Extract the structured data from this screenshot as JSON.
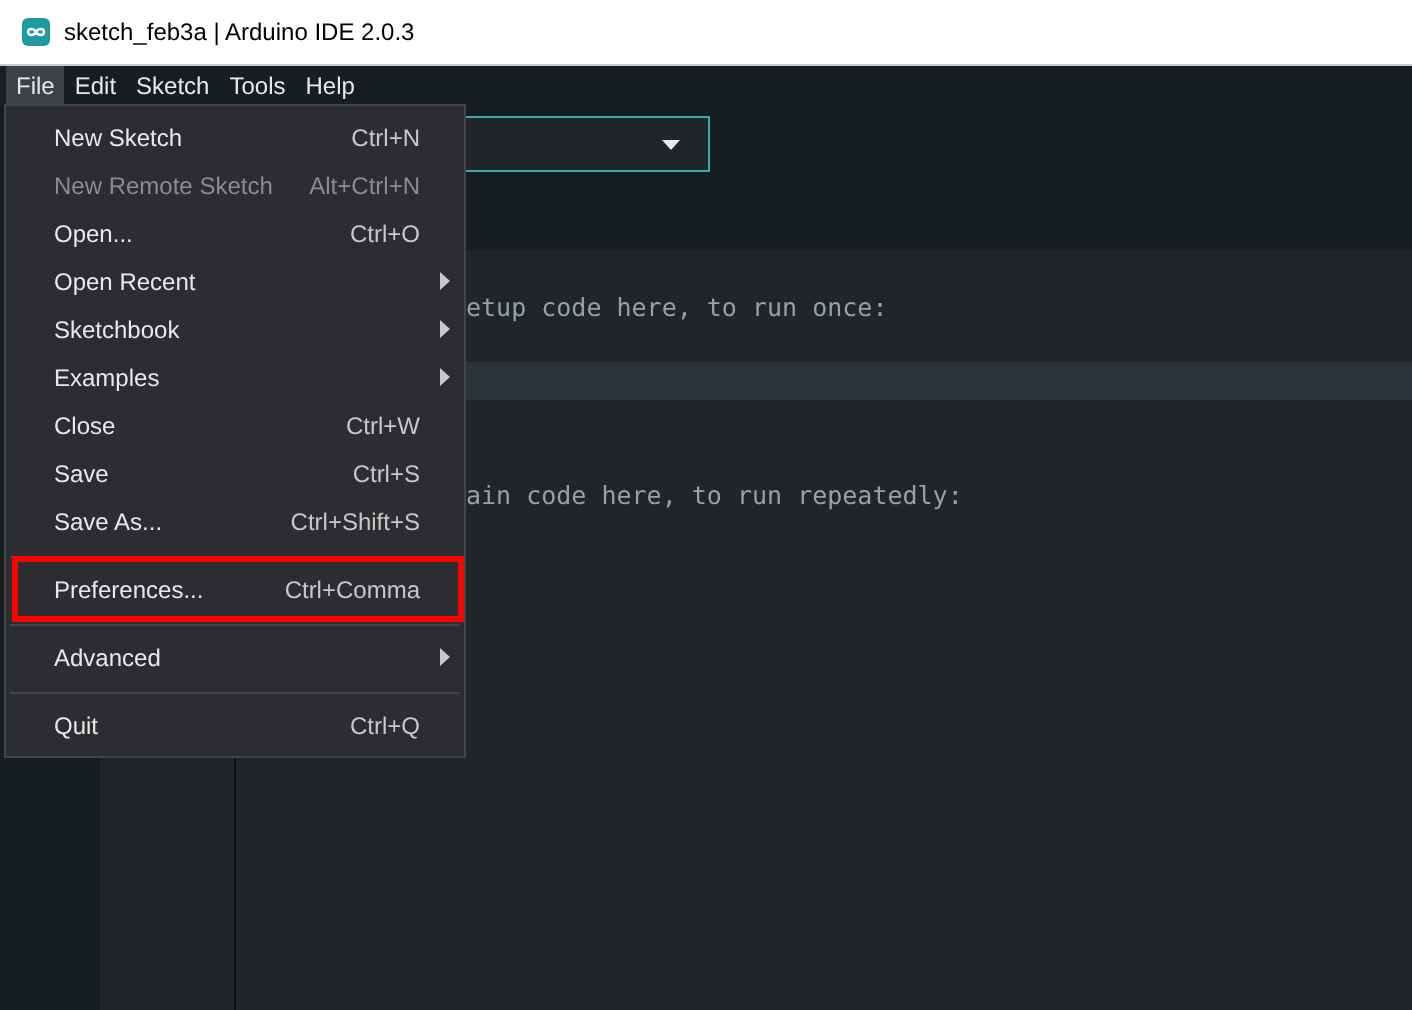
{
  "window": {
    "title": "sketch_feb3a | Arduino IDE 2.0.3"
  },
  "menubar": [
    {
      "label": "File",
      "selected": true
    },
    {
      "label": "Edit",
      "selected": false
    },
    {
      "label": "Sketch",
      "selected": false
    },
    {
      "label": "Tools",
      "selected": false
    },
    {
      "label": "Help",
      "selected": false
    }
  ],
  "file_menu": [
    [
      {
        "label": "New Sketch",
        "shortcut": "Ctrl+N",
        "disabled": false,
        "submenu": false,
        "annotated": false
      },
      {
        "label": "New Remote Sketch",
        "shortcut": "Alt+Ctrl+N",
        "disabled": true,
        "submenu": false,
        "annotated": false
      },
      {
        "label": "Open...",
        "shortcut": "Ctrl+O",
        "disabled": false,
        "submenu": false,
        "annotated": false
      },
      {
        "label": "Open Recent",
        "disabled": false,
        "submenu": true,
        "annotated": false
      },
      {
        "label": "Sketchbook",
        "disabled": false,
        "submenu": true,
        "annotated": false
      },
      {
        "label": "Examples",
        "disabled": false,
        "submenu": true,
        "annotated": false
      },
      {
        "label": "Close",
        "shortcut": "Ctrl+W",
        "disabled": false,
        "submenu": false,
        "annotated": false
      },
      {
        "label": "Save",
        "shortcut": "Ctrl+S",
        "disabled": false,
        "submenu": false,
        "annotated": false
      },
      {
        "label": "Save As...",
        "shortcut": "Ctrl+Shift+S",
        "disabled": false,
        "submenu": false,
        "annotated": false
      }
    ],
    [
      {
        "label": "Preferences...",
        "shortcut": "Ctrl+Comma",
        "disabled": false,
        "submenu": false,
        "annotated": true
      }
    ],
    [
      {
        "label": "Advanced",
        "disabled": false,
        "submenu": true,
        "annotated": false
      }
    ],
    [
      {
        "label": "Quit",
        "shortcut": "Ctrl+Q",
        "disabled": false,
        "submenu": false,
        "annotated": false
      }
    ]
  ],
  "editor": {
    "lines": [
      {
        "current": false
      },
      {
        "text": "etup code here, to run once:",
        "current": false
      },
      {
        "current": false
      },
      {
        "current": true
      },
      {
        "current": false
      },
      {
        "current": false
      },
      {
        "text": "ain code here, to run repeatedly:",
        "current": false
      }
    ]
  }
}
